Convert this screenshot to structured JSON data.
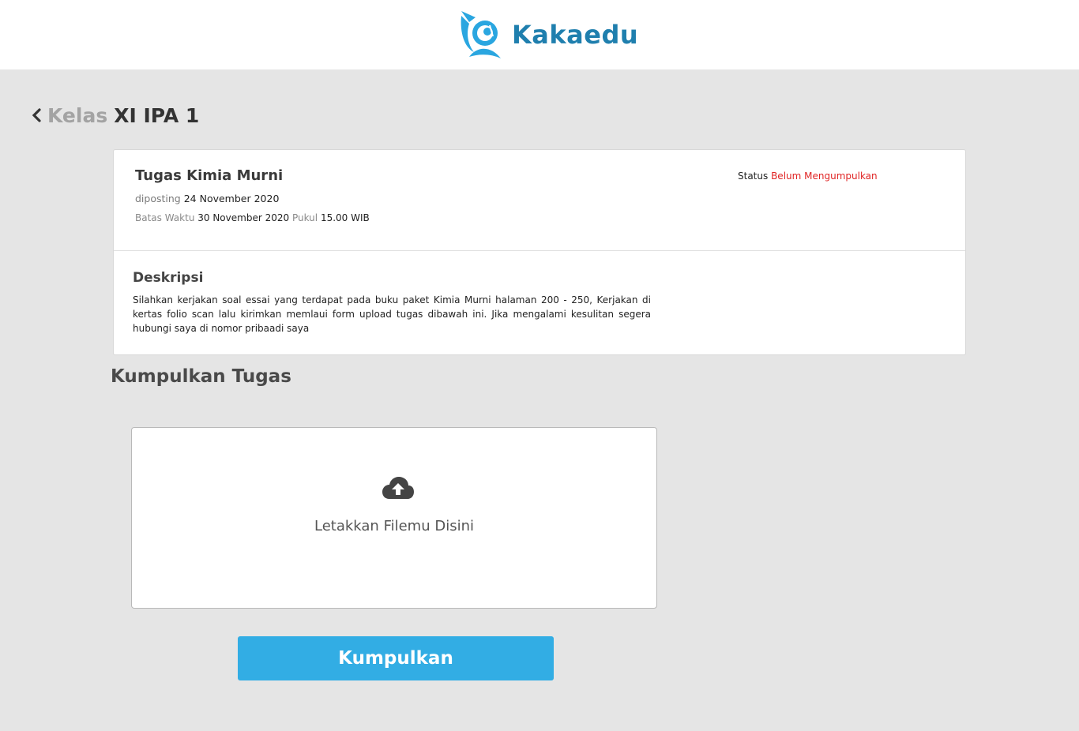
{
  "brand": {
    "name": "Kakaedu",
    "color": "#1f7fae",
    "logo_icon": "kakaedu-bird-logo"
  },
  "breadcrumb": {
    "back_icon": "chevron-left-icon",
    "parent": "Kelas",
    "current": "XI IPA 1"
  },
  "task": {
    "title": "Tugas Kimia Murni",
    "posted_label": "diposting",
    "posted_date": "24 November 2020",
    "deadline_label": "Batas Waktu",
    "deadline_date": "30 November 2020",
    "time_label": "Pukul",
    "time_value": "15.00 WIB",
    "status_label": "Status",
    "status_value": "Belum Mengumpulkan",
    "status_color": "#e02424"
  },
  "description": {
    "title": "Deskripsi",
    "body": "Silahkan kerjakan soal essai yang terdapat pada buku paket Kimia Murni halaman 200 - 250, Kerjakan di kertas folio scan lalu kirimkan memlaui form upload tugas dibawah ini. Jika mengalami kesulitan segera hubungi saya di nomor pribaadi saya"
  },
  "submission": {
    "title": "Kumpulkan Tugas",
    "upload_icon": "cloud-upload-icon",
    "dropzone_text": "Letakkan Filemu Disini",
    "submit_label": "Kumpulkan",
    "submit_color": "#32ade4"
  }
}
